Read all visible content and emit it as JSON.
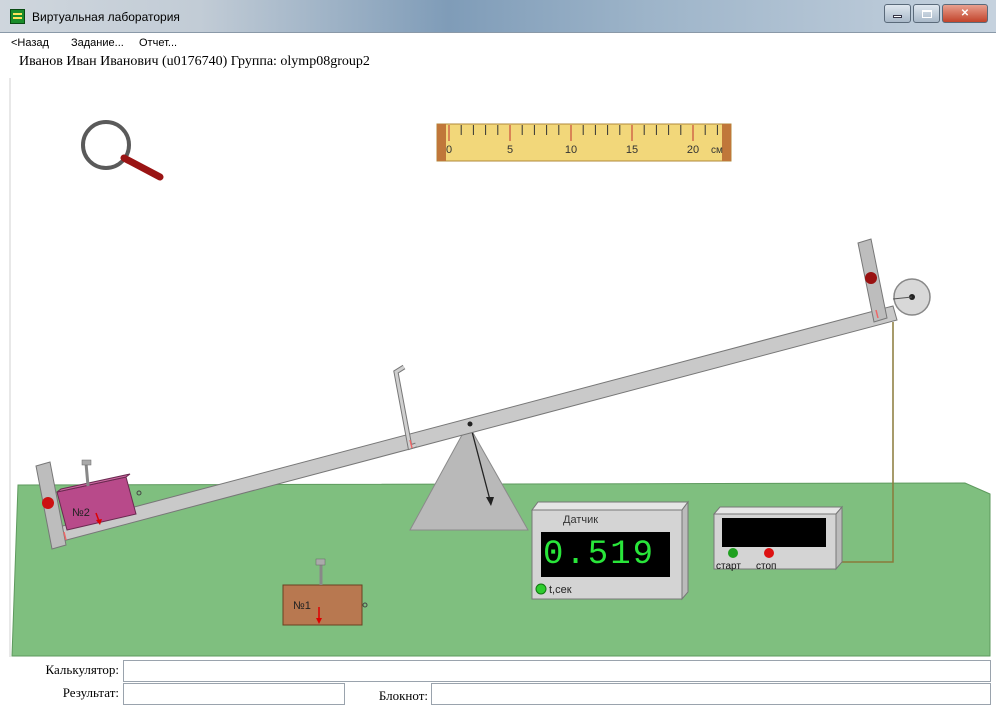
{
  "window": {
    "title": "Виртуальная лаборатория"
  },
  "menu": [
    {
      "label": "<Назад"
    },
    {
      "label": "Задание..."
    },
    {
      "label": "Отчет..."
    }
  ],
  "user_line": "Иванов Иван Иванович (u0176740)  Группа: olymp08group2",
  "ruler": {
    "tick_labels": [
      "0",
      "5",
      "10",
      "15",
      "20"
    ],
    "unit": "см"
  },
  "blocks": {
    "block_on_beam": "№2",
    "block_on_floor": "№1"
  },
  "sensor": {
    "label": "Датчик",
    "value": "0.519",
    "unit_label": "t,сек"
  },
  "stopwatch": {
    "start_label": "старт",
    "stop_label": "стоп"
  },
  "bottom": {
    "calculator_label": "Калькулятор:",
    "calculator_value": "",
    "result_label": "Результат:",
    "result_value": "",
    "notepad_label": "Блокнот:",
    "notepad_value": ""
  },
  "colors": {
    "ground": "#7fbf7f",
    "beam": "#c9c9c9",
    "block2": "#b84a8a",
    "block1": "#b87850",
    "display_text": "#29e63a",
    "ruler": "#f2d77a"
  }
}
